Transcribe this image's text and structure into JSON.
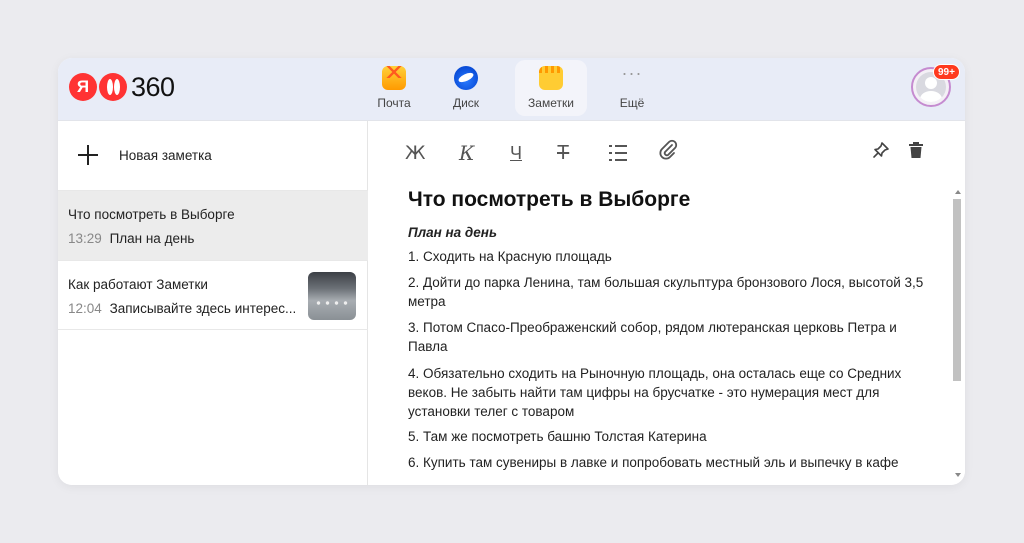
{
  "header": {
    "logo_num": "360",
    "logo_ya": "Я",
    "nav": [
      {
        "label": "Почта",
        "icon": "mail-icon"
      },
      {
        "label": "Диск",
        "icon": "disk-icon"
      },
      {
        "label": "Заметки",
        "icon": "notes-icon",
        "active": true
      },
      {
        "label": "Ещё",
        "icon": "more-icon"
      }
    ],
    "badge": "99+"
  },
  "sidebar": {
    "new_note_label": "Новая заметка",
    "notes": [
      {
        "title": "Что посмотреть в Выборге",
        "time": "13:29",
        "preview": "План на день",
        "active": true
      },
      {
        "title": "Как работают Заметки",
        "time": "12:04",
        "preview": "Записывайте здесь интерес...",
        "has_thumbnail": true
      }
    ]
  },
  "toolbar": {
    "bold": "Ж",
    "italic": "К",
    "underline": "Ч",
    "strike": "Т"
  },
  "editor": {
    "title": "Что посмотреть в Выборге",
    "subtitle": "План на день",
    "paragraphs": [
      "1. Сходить на Красную площадь",
      "2. Дойти до парка Ленина, там большая скульптура бронзового Лося, высотой 3,5 метра",
      "3. Потом Спасо-Преображенский собор, рядом лютеранская церковь Петра и Павла",
      "4. Обязательно сходить на Рыночную площадь, она осталась еще со Средних веков. Не забыть найти там цифры на брусчатке - это нумерация мест для установки телег с товаром",
      "5. Там же посмотреть башню Толстая Катерина",
      "6. Купить там сувениры в лавке и попробовать местный эль и выпечку в кафе"
    ]
  },
  "colors": {
    "header_bg": "#e8ecf7",
    "brand_red": "#ff3333",
    "active_note_bg": "#ececec",
    "badge": "#ff3a1f"
  }
}
